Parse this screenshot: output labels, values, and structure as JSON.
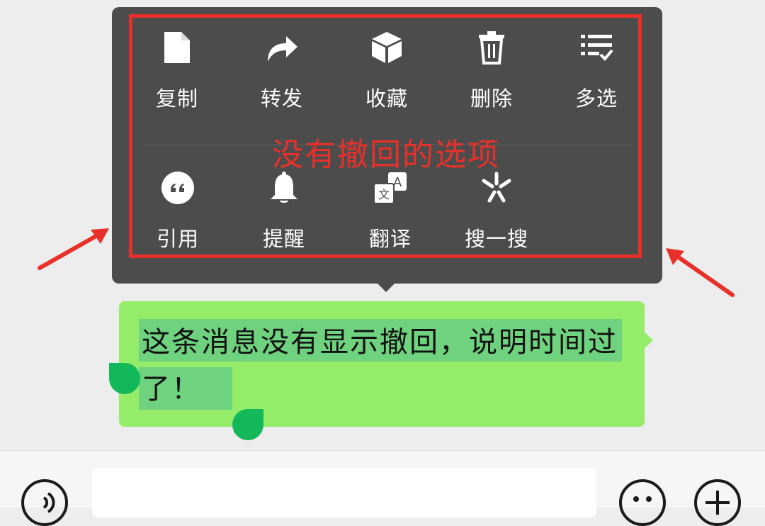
{
  "menu": {
    "row1": [
      {
        "label": "复制",
        "icon": "copy-icon"
      },
      {
        "label": "转发",
        "icon": "forward-icon"
      },
      {
        "label": "收藏",
        "icon": "favorite-box-icon"
      },
      {
        "label": "删除",
        "icon": "trash-icon"
      },
      {
        "label": "多选",
        "icon": "multi-select-icon"
      }
    ],
    "row2": [
      {
        "label": "引用",
        "icon": "quote-icon"
      },
      {
        "label": "提醒",
        "icon": "bell-icon"
      },
      {
        "label": "翻译",
        "icon": "translate-icon"
      },
      {
        "label": "搜一搜",
        "icon": "search-sparkle-icon"
      }
    ]
  },
  "annotation": {
    "text": "没有撤回的选项",
    "color": "#e8302a"
  },
  "message": {
    "text": "这条消息没有显示撤回，说明时间过了！",
    "bubble_color": "#95ec69"
  },
  "input_bar": {
    "left_icon": "voice-icon",
    "right_icons": [
      "emoji-icon",
      "plus-icon"
    ]
  },
  "colors": {
    "menu_bg": "#4c4c4c",
    "selection": "#6fd27e",
    "handle": "#13b85a"
  }
}
